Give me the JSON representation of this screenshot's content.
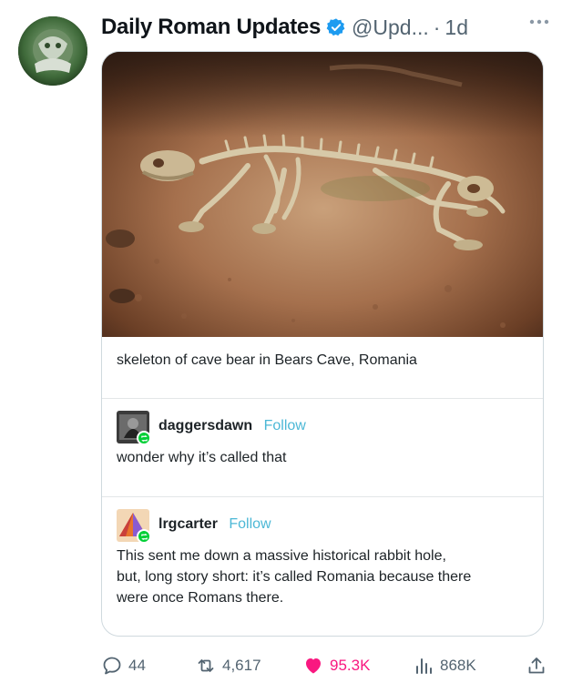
{
  "tweet": {
    "display_name": "Daily Roman Updates",
    "handle": "@Upd...",
    "separator": "·",
    "time": "1d",
    "avatar_icon": "green-emblem-avatar",
    "verified_color": "#1d9bf0"
  },
  "post": {
    "image_icon": "cave-bear-skeleton-photo",
    "caption": "skeleton of cave bear in Bears Cave, Romania",
    "reblogs": [
      {
        "username": "daggersdawn",
        "follow_label": "Follow",
        "text_lines": [
          "wonder why it’s called that"
        ]
      },
      {
        "username": "lrgcarter",
        "follow_label": "Follow",
        "text_lines": [
          "This sent me down a massive historical rabbit hole,",
          "but, long story short: it’s called Romania because there",
          "were once Romans there."
        ]
      }
    ]
  },
  "actions": {
    "replies": "44",
    "reposts": "4,617",
    "likes": "95.3K",
    "views": "868K",
    "like_color": "#f91880",
    "accent_color": "#1d9bf0"
  }
}
